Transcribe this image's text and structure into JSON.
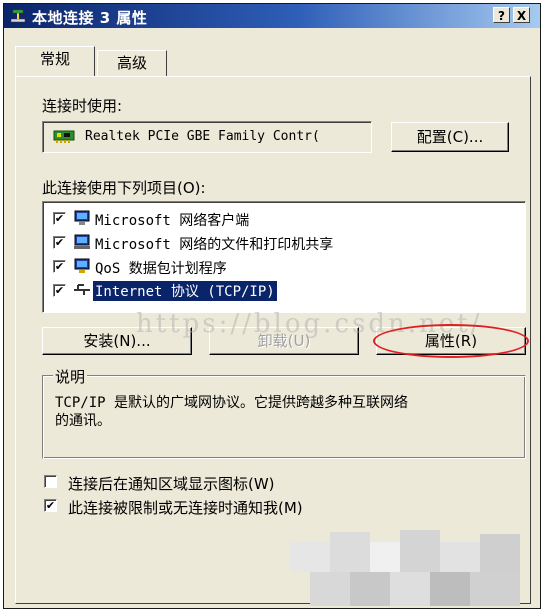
{
  "window": {
    "title": "本地连接 3 属性",
    "help_label": "?",
    "close_label": "X"
  },
  "tabs": [
    {
      "label": "常规",
      "active": true
    },
    {
      "label": "高级",
      "active": false
    }
  ],
  "connect_using": {
    "label": "连接时使用:",
    "adapter": "Realtek PCIe GBE Family Contr(",
    "configure_button": "配置(C)..."
  },
  "components": {
    "label": "此连接使用下列项目(O):",
    "items": [
      {
        "checked": true,
        "label": "Microsoft 网络客户端",
        "icon": "network-client-icon"
      },
      {
        "checked": true,
        "label": "Microsoft 网络的文件和打印机共享",
        "icon": "file-printer-sharing-icon"
      },
      {
        "checked": true,
        "label": "QoS 数据包计划程序",
        "icon": "qos-scheduler-icon"
      },
      {
        "checked": true,
        "label": "Internet 协议 (TCP/IP)",
        "icon": "protocol-icon",
        "selected": true
      }
    ]
  },
  "buttons": {
    "install": "安装(N)...",
    "uninstall": "卸载(U)",
    "properties": "属性(R)"
  },
  "description": {
    "title": "说明",
    "text_line1": "TCP/IP 是默认的广域网协议。它提供跨越多种互联网络",
    "text_line2": "的通讯。"
  },
  "options": [
    {
      "checked": false,
      "label": "连接后在通知区域显示图标(W)"
    },
    {
      "checked": true,
      "label": "此连接被限制或无连接时通知我(M)"
    }
  ],
  "watermark": "https://blog.csdn.net/",
  "check_glyph": "✔",
  "colors": {
    "title_bar": "#0b246a",
    "dialog_bg": "#ece9d8",
    "selection": "#0a246a",
    "annotation": "#e02020"
  }
}
